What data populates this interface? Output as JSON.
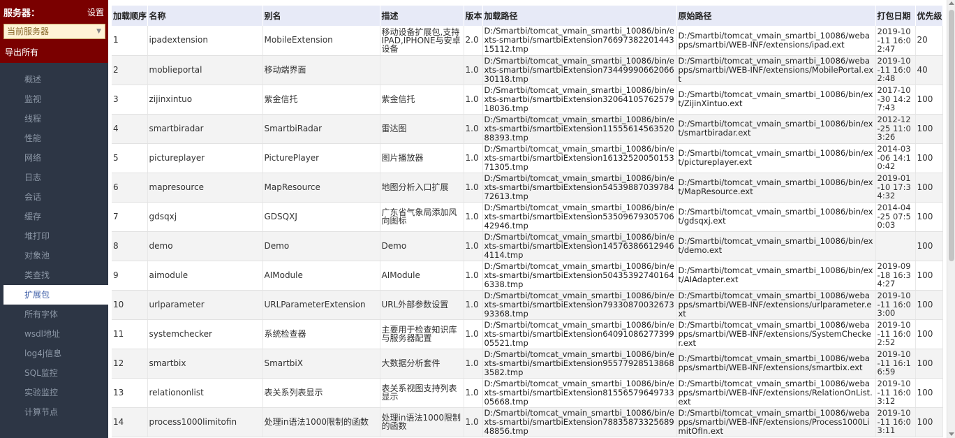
{
  "sidebar": {
    "server_label": "服务器：",
    "settings_label": "设置",
    "server_select_value": "当前服务器",
    "export_all_label": "导出所有",
    "items": [
      {
        "label": "概述"
      },
      {
        "label": "监视"
      },
      {
        "label": "线程"
      },
      {
        "label": "性能"
      },
      {
        "label": "网络"
      },
      {
        "label": "日志"
      },
      {
        "label": "会话"
      },
      {
        "label": "缓存"
      },
      {
        "label": "堆打印"
      },
      {
        "label": "对象池"
      },
      {
        "label": "类查找"
      },
      {
        "label": "扩展包"
      },
      {
        "label": "所有字体"
      },
      {
        "label": "wsdl地址"
      },
      {
        "label": "log4j信息"
      },
      {
        "label": "SQL监控"
      },
      {
        "label": "实验监控"
      },
      {
        "label": "计算节点"
      }
    ],
    "active_item": "扩展包"
  },
  "table": {
    "headers": [
      "加载顺序",
      "名称",
      "别名",
      "描述",
      "版本",
      "加载路径",
      "原始路径",
      "打包日期",
      "优先级"
    ],
    "rows": [
      {
        "order": "1",
        "name": "ipadextension",
        "alias": "MobileExtension",
        "desc": "移动设备扩展包,支持IPAD,IPHONE与安卓设备",
        "version": "2.0",
        "load_path": "D:/Smartbi/tomcat_vmain_smartbi_10086/bin/exts-smartbi/smartbiExtension7669738220144315112.tmp",
        "orig_path": "D:/Smartbi/tomcat_vmain_smartbi_10086/webapps/smartbi/WEB-INF/extensions/ipad.ext",
        "date": "2019-10-11 16:02:47",
        "priority": "20"
      },
      {
        "order": "2",
        "name": "moblieportal",
        "alias": "移动端界面",
        "desc": "",
        "version": "1.0",
        "load_path": "D:/Smartbi/tomcat_vmain_smartbi_10086/bin/exts-smartbi/smartbiExtension7344999066206630118.tmp",
        "orig_path": "D:/Smartbi/tomcat_vmain_smartbi_10086/webapps/smartbi/WEB-INF/extensions/MobilePortal.ext",
        "date": "2019-10-11 16:02:48",
        "priority": "40"
      },
      {
        "order": "3",
        "name": "zijinxintuo",
        "alias": "紫金信托",
        "desc": "紫金信托",
        "version": "1.0",
        "load_path": "D:/Smartbi/tomcat_vmain_smartbi_10086/bin/exts-smartbi/smartbiExtension3206410576257918036.tmp",
        "orig_path": "D:/Smartbi/tomcat_vmain_smartbi_10086/bin/ext/ZijinXintuo.ext",
        "date": "2017-10-30 14:27:43",
        "priority": "100"
      },
      {
        "order": "4",
        "name": "smartbiradar",
        "alias": "SmartbiRadar",
        "desc": "雷达图",
        "version": "1.0",
        "load_path": "D:/Smartbi/tomcat_vmain_smartbi_10086/bin/exts-smartbi/smartbiExtension1155561456352088393.tmp",
        "orig_path": "D:/Smartbi/tomcat_vmain_smartbi_10086/bin/ext/smartbiradar.ext",
        "date": "2012-12-25 11:03:26",
        "priority": "100"
      },
      {
        "order": "5",
        "name": "pictureplayer",
        "alias": "PicturePlayer",
        "desc": "图片播放器",
        "version": "1.0",
        "load_path": "D:/Smartbi/tomcat_vmain_smartbi_10086/bin/exts-smartbi/smartbiExtension1613252005015371305.tmp",
        "orig_path": "D:/Smartbi/tomcat_vmain_smartbi_10086/bin/ext/pictureplayer.ext",
        "date": "2014-03-06 14:10:42",
        "priority": "100"
      },
      {
        "order": "6",
        "name": "mapresource",
        "alias": "MapResource",
        "desc": "地图分析入口扩展",
        "version": "1.0",
        "load_path": "D:/Smartbi/tomcat_vmain_smartbi_10086/bin/exts-smartbi/smartbiExtension5453988703978472613.tmp",
        "orig_path": "D:/Smartbi/tomcat_vmain_smartbi_10086/bin/ext/MapResource.ext",
        "date": "2019-01-10 17:34:32",
        "priority": "100"
      },
      {
        "order": "7",
        "name": "gdsqxj",
        "alias": "GDSQXJ",
        "desc": "广东省气象局添加风向图标",
        "version": "1.0",
        "load_path": "D:/Smartbi/tomcat_vmain_smartbi_10086/bin/exts-smartbi/smartbiExtension5350967930570642946.tmp",
        "orig_path": "D:/Smartbi/tomcat_vmain_smartbi_10086/bin/ext/gdsqxj.ext",
        "date": "2014-04-25 07:50:03",
        "priority": "100"
      },
      {
        "order": "8",
        "name": "demo",
        "alias": "Demo",
        "desc": "Demo",
        "version": "1.0",
        "load_path": "D:/Smartbi/tomcat_vmain_smartbi_10086/bin/exts-smartbi/smartbiExtension145763866129464114.tmp",
        "orig_path": "D:/Smartbi/tomcat_vmain_smartbi_10086/bin/ext/demo.ext",
        "date": "",
        "priority": "100"
      },
      {
        "order": "9",
        "name": "aimodule",
        "alias": "AIModule",
        "desc": "AIModule",
        "version": "1.0",
        "load_path": "D:/Smartbi/tomcat_vmain_smartbi_10086/bin/exts-smartbi/smartbiExtension504353927401646338.tmp",
        "orig_path": "D:/Smartbi/tomcat_vmain_smartbi_10086/bin/ext/AIAdapter.ext",
        "date": "2019-09-18 16:34:27",
        "priority": "100"
      },
      {
        "order": "10",
        "name": "urlparameter",
        "alias": "URLParameterExtension",
        "desc": "URL外部参数设置",
        "version": "1.0",
        "load_path": "D:/Smartbi/tomcat_vmain_smartbi_10086/bin/exts-smartbi/smartbiExtension7933087003267393368.tmp",
        "orig_path": "D:/Smartbi/tomcat_vmain_smartbi_10086/webapps/smartbi/WEB-INF/extensions/urlparameter.ext",
        "date": "2019-10-11 16:03:00",
        "priority": "100"
      },
      {
        "order": "11",
        "name": "systemchecker",
        "alias": "系统检查器",
        "desc": "主要用于检查知识库与服务器配置",
        "version": "1.0",
        "load_path": "D:/Smartbi/tomcat_vmain_smartbi_10086/bin/exts-smartbi/smartbiExtension6409108627739905521.tmp",
        "orig_path": "D:/Smartbi/tomcat_vmain_smartbi_10086/webapps/smartbi/WEB-INF/extensions/SystemChecker.ext",
        "date": "2019-10-11 16:02:52",
        "priority": "100"
      },
      {
        "order": "12",
        "name": "smartbix",
        "alias": "SmartbiX",
        "desc": "大数据分析套件",
        "version": "1.0",
        "load_path": "D:/Smartbi/tomcat_vmain_smartbi_10086/bin/exts-smartbi/smartbiExtension955779285138683582.tmp",
        "orig_path": "D:/Smartbi/tomcat_vmain_smartbi_10086/webapps/smartbi/WEB-INF/extensions/smartbix.ext",
        "date": "2019-10-11 16:16:59",
        "priority": "100"
      },
      {
        "order": "13",
        "name": "relationonlist",
        "alias": "表关系列表显示",
        "desc": "表关系视图支持列表显示",
        "version": "1.0",
        "load_path": "D:/Smartbi/tomcat_vmain_smartbi_10086/bin/exts-smartbi/smartbiExtension8155657964973305668.tmp",
        "orig_path": "D:/Smartbi/tomcat_vmain_smartbi_10086/webapps/smartbi/WEB-INF/extensions/RelationOnList.ext",
        "date": "2019-10-11 16:03:12",
        "priority": "100"
      },
      {
        "order": "14",
        "name": "process1000limitofin",
        "alias": "处理in语法1000限制的函数",
        "desc": "处理in语法1000限制的函数",
        "version": "1.0",
        "load_path": "D:/Smartbi/tomcat_vmain_smartbi_10086/bin/exts-smartbi/smartbiExtension7883587332568948856.tmp",
        "orig_path": "D:/Smartbi/tomcat_vmain_smartbi_10086/webapps/smartbi/WEB-INF/extensions/Process1000LimitOfIn.ext",
        "date": "2019-10-11 16:03:11",
        "priority": "100"
      }
    ]
  }
}
